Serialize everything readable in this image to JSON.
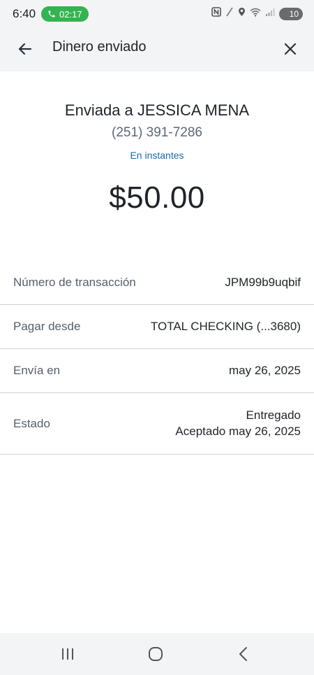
{
  "status_bar": {
    "time": "6:40",
    "call_duration": "02:17",
    "battery_level": "10",
    "icons": [
      "nfc-icon",
      "slash-icon",
      "location-icon",
      "wifi-icon",
      "signal-icon"
    ]
  },
  "header": {
    "title": "Dinero enviado",
    "back_icon": "arrow-left-icon",
    "close_icon": "close-icon"
  },
  "summary": {
    "prefix": "Enviada a",
    "recipient_name": "JESSICA MENA",
    "phone": "(251) 391-7286",
    "timing": "En instantes",
    "amount": "$50.00"
  },
  "details": [
    {
      "label": "Número de transacción",
      "value": "JPM99b9uqbif"
    },
    {
      "label": "Pagar desde",
      "value": "TOTAL CHECKING (...3680)"
    },
    {
      "label": "Envía en",
      "value": "may 26, 2025"
    },
    {
      "label": "Estado",
      "value": "Entregado",
      "value2": "Aceptado may 26, 2025"
    }
  ],
  "colors": {
    "accent_link": "#1a6aa8",
    "call_pill": "#34b350",
    "chrome_bg": "#f3f4f6"
  }
}
